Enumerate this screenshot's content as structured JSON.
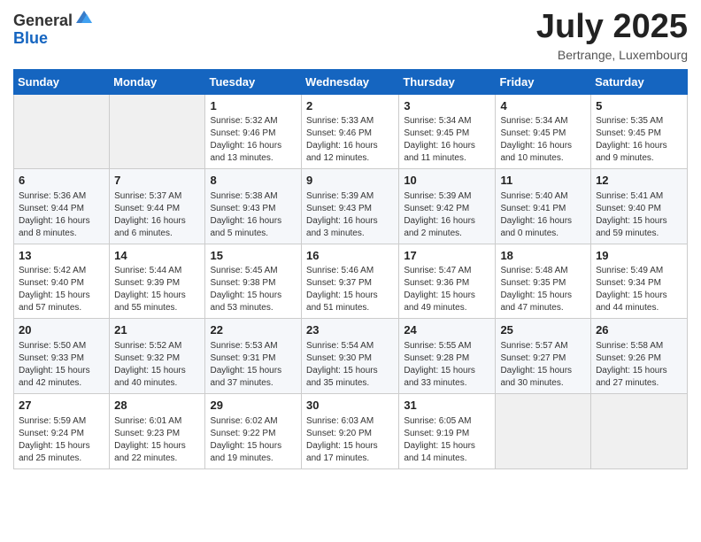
{
  "header": {
    "logo_line1": "General",
    "logo_line2": "Blue",
    "month_title": "July 2025",
    "location": "Bertrange, Luxembourg"
  },
  "weekdays": [
    "Sunday",
    "Monday",
    "Tuesday",
    "Wednesday",
    "Thursday",
    "Friday",
    "Saturday"
  ],
  "weeks": [
    [
      {
        "day": "",
        "info": ""
      },
      {
        "day": "",
        "info": ""
      },
      {
        "day": "1",
        "info": "Sunrise: 5:32 AM\nSunset: 9:46 PM\nDaylight: 16 hours\nand 13 minutes."
      },
      {
        "day": "2",
        "info": "Sunrise: 5:33 AM\nSunset: 9:46 PM\nDaylight: 16 hours\nand 12 minutes."
      },
      {
        "day": "3",
        "info": "Sunrise: 5:34 AM\nSunset: 9:45 PM\nDaylight: 16 hours\nand 11 minutes."
      },
      {
        "day": "4",
        "info": "Sunrise: 5:34 AM\nSunset: 9:45 PM\nDaylight: 16 hours\nand 10 minutes."
      },
      {
        "day": "5",
        "info": "Sunrise: 5:35 AM\nSunset: 9:45 PM\nDaylight: 16 hours\nand 9 minutes."
      }
    ],
    [
      {
        "day": "6",
        "info": "Sunrise: 5:36 AM\nSunset: 9:44 PM\nDaylight: 16 hours\nand 8 minutes."
      },
      {
        "day": "7",
        "info": "Sunrise: 5:37 AM\nSunset: 9:44 PM\nDaylight: 16 hours\nand 6 minutes."
      },
      {
        "day": "8",
        "info": "Sunrise: 5:38 AM\nSunset: 9:43 PM\nDaylight: 16 hours\nand 5 minutes."
      },
      {
        "day": "9",
        "info": "Sunrise: 5:39 AM\nSunset: 9:43 PM\nDaylight: 16 hours\nand 3 minutes."
      },
      {
        "day": "10",
        "info": "Sunrise: 5:39 AM\nSunset: 9:42 PM\nDaylight: 16 hours\nand 2 minutes."
      },
      {
        "day": "11",
        "info": "Sunrise: 5:40 AM\nSunset: 9:41 PM\nDaylight: 16 hours\nand 0 minutes."
      },
      {
        "day": "12",
        "info": "Sunrise: 5:41 AM\nSunset: 9:40 PM\nDaylight: 15 hours\nand 59 minutes."
      }
    ],
    [
      {
        "day": "13",
        "info": "Sunrise: 5:42 AM\nSunset: 9:40 PM\nDaylight: 15 hours\nand 57 minutes."
      },
      {
        "day": "14",
        "info": "Sunrise: 5:44 AM\nSunset: 9:39 PM\nDaylight: 15 hours\nand 55 minutes."
      },
      {
        "day": "15",
        "info": "Sunrise: 5:45 AM\nSunset: 9:38 PM\nDaylight: 15 hours\nand 53 minutes."
      },
      {
        "day": "16",
        "info": "Sunrise: 5:46 AM\nSunset: 9:37 PM\nDaylight: 15 hours\nand 51 minutes."
      },
      {
        "day": "17",
        "info": "Sunrise: 5:47 AM\nSunset: 9:36 PM\nDaylight: 15 hours\nand 49 minutes."
      },
      {
        "day": "18",
        "info": "Sunrise: 5:48 AM\nSunset: 9:35 PM\nDaylight: 15 hours\nand 47 minutes."
      },
      {
        "day": "19",
        "info": "Sunrise: 5:49 AM\nSunset: 9:34 PM\nDaylight: 15 hours\nand 44 minutes."
      }
    ],
    [
      {
        "day": "20",
        "info": "Sunrise: 5:50 AM\nSunset: 9:33 PM\nDaylight: 15 hours\nand 42 minutes."
      },
      {
        "day": "21",
        "info": "Sunrise: 5:52 AM\nSunset: 9:32 PM\nDaylight: 15 hours\nand 40 minutes."
      },
      {
        "day": "22",
        "info": "Sunrise: 5:53 AM\nSunset: 9:31 PM\nDaylight: 15 hours\nand 37 minutes."
      },
      {
        "day": "23",
        "info": "Sunrise: 5:54 AM\nSunset: 9:30 PM\nDaylight: 15 hours\nand 35 minutes."
      },
      {
        "day": "24",
        "info": "Sunrise: 5:55 AM\nSunset: 9:28 PM\nDaylight: 15 hours\nand 33 minutes."
      },
      {
        "day": "25",
        "info": "Sunrise: 5:57 AM\nSunset: 9:27 PM\nDaylight: 15 hours\nand 30 minutes."
      },
      {
        "day": "26",
        "info": "Sunrise: 5:58 AM\nSunset: 9:26 PM\nDaylight: 15 hours\nand 27 minutes."
      }
    ],
    [
      {
        "day": "27",
        "info": "Sunrise: 5:59 AM\nSunset: 9:24 PM\nDaylight: 15 hours\nand 25 minutes."
      },
      {
        "day": "28",
        "info": "Sunrise: 6:01 AM\nSunset: 9:23 PM\nDaylight: 15 hours\nand 22 minutes."
      },
      {
        "day": "29",
        "info": "Sunrise: 6:02 AM\nSunset: 9:22 PM\nDaylight: 15 hours\nand 19 minutes."
      },
      {
        "day": "30",
        "info": "Sunrise: 6:03 AM\nSunset: 9:20 PM\nDaylight: 15 hours\nand 17 minutes."
      },
      {
        "day": "31",
        "info": "Sunrise: 6:05 AM\nSunset: 9:19 PM\nDaylight: 15 hours\nand 14 minutes."
      },
      {
        "day": "",
        "info": ""
      },
      {
        "day": "",
        "info": ""
      }
    ]
  ]
}
